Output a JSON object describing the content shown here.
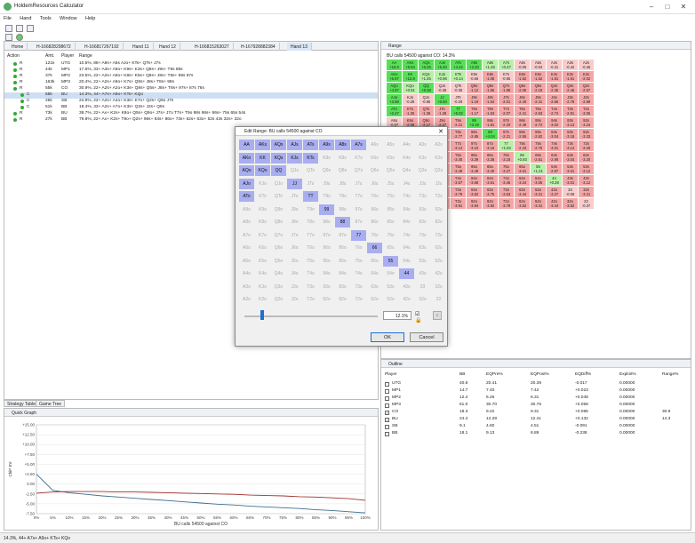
{
  "window": {
    "title": "HoldemResources Calculator"
  },
  "menu": [
    "File",
    "Hand",
    "Tools",
    "Window",
    "Help"
  ],
  "tabs": [
    "Home",
    "H-166828298672",
    "H-166817267192",
    "Hand 11",
    "Hand 12",
    "H-166815263027",
    "H-167928882384",
    "Hand 13"
  ],
  "hand_table": {
    "headers": [
      "Action",
      "Amt.",
      "Player",
      "Range"
    ],
    "rows": [
      {
        "action": "R",
        "amt": "121k",
        "player": "UTG",
        "range": "10.5%, 88+ A9s+ A5s AJo+ KTs+ QTs+ J7s"
      },
      {
        "action": "R",
        "amt": "44k",
        "player": "MP1",
        "range": "17.6%, 33+ A3s+ A9o+ K9s+ K3s+ Q8s+ J9s+ T9s 89s"
      },
      {
        "action": "R",
        "amt": "37k",
        "player": "MP2",
        "range": "23.5%, 22+ A2s+ A8o+ K8s+ K5s+ Q8s+ J8s+ T8s+ 98s 87s"
      },
      {
        "action": "R",
        "amt": "163k",
        "player": "MP3",
        "range": "20.4%, 22+ A2s+ A9o+ K7s+ Q9s+ J8s+ T8s+ 98s"
      },
      {
        "action": "R",
        "amt": "55k",
        "player": "CO",
        "range": "30.9%, 22+ A2s+ A2o+ K3s+ Q8s+ Q5s+ J8s+ T8s+ 97s+ 87s 76s"
      },
      {
        "action": "C",
        "amt": "55k",
        "player": "BU",
        "range": "14.3%, 44+ A7s+ A9o+ KTs+ KQo"
      },
      {
        "action": "C",
        "amt": "25k",
        "player": "SB",
        "range": "24.9%, 22+ A2s+ A4o+ K3s+ K7o+ Q2s+ Q9o J7s"
      },
      {
        "action": "C",
        "amt": "51k",
        "player": "BB",
        "range": "18.4%, 33+ A2s+ A7o+ K3s+ Q3s+ J2s+ Q9s"
      },
      {
        "action": "R",
        "amt": "73k",
        "player": "BU",
        "range": "39.7%, 22+ Ax+ K2s+ K8o+ Q5s+ Q9o+ J7s+ J7o T7s+ T9o 98s 96s+ 86s+ 75s 65s 54s"
      },
      {
        "action": "R",
        "amt": "27k",
        "player": "BB",
        "range": "79.8%, 22+ Ax+ K2s+ T8o+ Q2s+ 96s+ 84s+ 86o+ 73s+ 62s+ 63o+ 52s 43s 32s+ 32o"
      }
    ]
  },
  "bottom_tabs": [
    "Strategy Table",
    "Game Tree"
  ],
  "graph": {
    "title": "Quick Graph",
    "chart_data": {
      "type": "line",
      "x": [
        0,
        5,
        10,
        15,
        20,
        25,
        30,
        35,
        40,
        45,
        50,
        55,
        60,
        65,
        70,
        75,
        80,
        85,
        90,
        95,
        100
      ],
      "series": [
        {
          "values": [
            2.5,
            -1.6,
            -2.2,
            -2.6,
            -3.0,
            -3.3,
            -3.6,
            -3.9,
            -4.2,
            -4.5,
            -4.8,
            -5.1,
            -5.3,
            -5.6,
            -5.8,
            -6.0,
            -6.2,
            -6.5,
            -6.7,
            -7.0,
            -7.3
          ],
          "color": "#3f6f8f"
        },
        {
          "values": [
            -2.3,
            -2.0,
            -1.9,
            -1.9,
            -1.9,
            -2.0,
            -2.0,
            -2.1,
            -2.2,
            -2.3,
            -2.4,
            -2.5,
            -2.6,
            -2.8,
            -2.9,
            -3.0,
            -3.2,
            -3.3,
            -3.5,
            -3.7,
            -4.1
          ],
          "color": "#a03030"
        }
      ],
      "yticks": [
        "+15.00",
        "+12.50",
        "+10.00",
        "+7.50",
        "+5.00",
        "+2.50",
        "0.00",
        "-2.50",
        "-5.00",
        "-7.50"
      ],
      "xticks": [
        "0%",
        "5%",
        "10%",
        "15%",
        "20%",
        "25%",
        "30%",
        "35%",
        "40%",
        "45%",
        "50%",
        "55%",
        "60%",
        "65%",
        "70%",
        "75%",
        "80%",
        "85%",
        "90%",
        "95%",
        "100%"
      ],
      "ylim": [
        -7.5,
        15
      ],
      "xlabel": "BU calls 54500 against CO",
      "ylabel": "ChiP EV"
    }
  },
  "range_panel": {
    "head": "Range",
    "title": "BU calls 54500 against CO: 14.3%",
    "grid": [
      [
        "AA",
        "AKs",
        "AQs",
        "AJs",
        "ATs",
        "A9s",
        "A8s",
        "A7s",
        "A6s",
        "A5s",
        "A4s",
        "A3s",
        "A2s"
      ],
      [
        "AKo",
        "KK",
        "KQs",
        "KJs",
        "KTs",
        "K9s",
        "K8s",
        "K7s",
        "K6s",
        "K5s",
        "K4s",
        "K3s",
        "K2s"
      ],
      [
        "AQo",
        "KQo",
        "QQ",
        "QJs",
        "QTs",
        "Q9s",
        "Q8s",
        "Q7s",
        "Q6s",
        "Q5s",
        "Q4s",
        "Q3s",
        "Q2s"
      ],
      [
        "AJo",
        "KJo",
        "QJo",
        "JJ",
        "JTs",
        "J9s",
        "J8s",
        "J7s",
        "J6s",
        "J5s",
        "J4s",
        "J3s",
        "J2s"
      ],
      [
        "ATo",
        "KTo",
        "QTo",
        "JTo",
        "TT",
        "T9s",
        "T8s",
        "T7s",
        "T6s",
        "T5s",
        "T4s",
        "T3s",
        "T2s"
      ],
      [
        "A9o",
        "K9o",
        "Q9o",
        "J9o",
        "T9o",
        "99",
        "98s",
        "97s",
        "96s",
        "95s",
        "94s",
        "93s",
        "92s"
      ],
      [
        "A8o",
        "K8o",
        "Q8o",
        "J8o",
        "T8o",
        "98o",
        "88",
        "87s",
        "86s",
        "85s",
        "84s",
        "83s",
        "82s"
      ],
      [
        "A7o",
        "K7o",
        "Q7o",
        "J7o",
        "T7o",
        "97o",
        "87o",
        "77",
        "76s",
        "75s",
        "74s",
        "73s",
        "72s"
      ],
      [
        "A6o",
        "K6o",
        "Q6o",
        "J6o",
        "T6o",
        "96o",
        "86o",
        "76o",
        "66",
        "65s",
        "64s",
        "63s",
        "62s"
      ],
      [
        "A5o",
        "K5o",
        "Q5o",
        "J5o",
        "T5o",
        "95o",
        "85o",
        "75o",
        "65o",
        "55",
        "54s",
        "53s",
        "52s"
      ],
      [
        "A4o",
        "K4o",
        "Q4o",
        "J4o",
        "T4o",
        "94o",
        "84o",
        "74o",
        "64o",
        "54o",
        "44",
        "43s",
        "42s"
      ],
      [
        "A3o",
        "K3o",
        "Q3o",
        "J3o",
        "T3o",
        "93o",
        "83o",
        "73o",
        "63o",
        "53o",
        "43o",
        "33",
        "32s"
      ],
      [
        "A2o",
        "K2o",
        "Q2o",
        "J2o",
        "T2o",
        "92o",
        "82o",
        "72o",
        "62o",
        "52o",
        "42o",
        "32o",
        "22"
      ]
    ],
    "values": [
      [
        "+15.8",
        "+8.94",
        "+6.25",
        "+5.40",
        "+4.42",
        "+2.20",
        "+1.45",
        "+0.47",
        "-0.06",
        "-0.04",
        "-0.31",
        "-0.42",
        "-0.46"
      ],
      [
        "+6.97",
        "+12.8",
        "+1.45",
        "+0.96",
        "+0.14",
        "-0.66",
        "-1.08",
        "-0.95",
        "-1.62",
        "-1.52",
        "-1.81",
        "-1.91",
        "-2.02"
      ],
      [
        "+4.97",
        "+0.91",
        "+8.38",
        "-0.38",
        "-0.35",
        "-1.12",
        "-1.55",
        "-1.88",
        "-2.09",
        "-2.19",
        "-2.35",
        "-2.46",
        "-2.57"
      ],
      [
        "+3.98",
        "-0.28",
        "-0.86",
        "+6.60",
        "-0.29",
        "-1.19",
        "-1.64",
        "-2.01",
        "-2.40",
        "-2.41",
        "-2.65",
        "-2.78",
        "-2.89"
      ],
      [
        "+2.47",
        "-1.25",
        "-1.36",
        "-1.28",
        "+5.02",
        "-1.17",
        "-1.63",
        "-2.07",
        "-2.41",
        "-2.63",
        "-2.74",
        "-2.91",
        "-3.05"
      ],
      [
        "-0.07",
        "-2.08",
        "-2.17",
        "-2.27",
        "-2.21",
        "+3.19",
        "-1.81",
        "-2.20",
        "-2.49",
        "-2.72",
        "-3.02",
        "-3.13",
        "-3.24"
      ],
      [
        "-1.18",
        "-2.42",
        "-2.65",
        "-2.79",
        "-2.77",
        "-2.85",
        "+4.04",
        "-2.21",
        "-2.55",
        "-2.82",
        "-3.04",
        "-3.18",
        "-3.33"
      ],
      [
        "-1.64",
        "-2.90",
        "-3.01",
        "-3.13",
        "-3.14",
        "-3.10",
        "-3.16",
        "+1.94",
        "-2.43",
        "-2.76",
        "-3.01",
        "-3.14",
        "-3.26"
      ],
      [
        "-2.28",
        "-3.18",
        "-3.29",
        "-3.42",
        "-3.40",
        "-3.39",
        "-3.36",
        "-3.18",
        "+0.93",
        "-2.61",
        "-2.90",
        "-3.04",
        "-3.20"
      ],
      [
        "-2.09",
        "-3.24",
        "-3.36",
        "-3.46",
        "-3.49",
        "-3.49",
        "-3.40",
        "-3.27",
        "-3.01",
        "+1.21",
        "-2.87",
        "-3.01",
        "-3.12"
      ],
      [
        "-2.47",
        "-3.42",
        "-3.55",
        "-3.64",
        "-3.67",
        "-3.68",
        "-3.61",
        "-3.45",
        "-3.24",
        "-3.05",
        "+0.28",
        "-3.01",
        "-3.12"
      ],
      [
        "-2.69",
        "-3.48",
        "-3.67",
        "-3.75",
        "-3.79",
        "-3.82",
        "-3.75",
        "-3.63",
        "-3.44",
        "-3.21",
        "-3.27",
        "-0.08",
        "-3.21"
      ],
      [
        "-2.76",
        "-3.55",
        "-3.76",
        "-3.87",
        "-3.91",
        "-3.94",
        "-3.92",
        "-3.79",
        "-3.62",
        "-3.41",
        "-3.44",
        "-3.52",
        "-0.37"
      ]
    ],
    "colors": {
      "pos_strong": "#56e056",
      "pos_weak": "#b8f0a8",
      "neg": "#f4a6a6",
      "neg_weak": "#f9cccc"
    }
  },
  "outline": {
    "head": "Outline",
    "headers": [
      "Player",
      "BB",
      "EQPre%",
      "EQPost%",
      "EQDiff%",
      "Exploit%",
      "Range%"
    ],
    "rows": [
      {
        "checked": false,
        "player": "UTG",
        "bb": "40.6",
        "eqpre": "20.41",
        "eqpost": "20.39",
        "eqdiff": "-0.017",
        "exploit": "0.00000",
        "range": ""
      },
      {
        "checked": false,
        "player": "MP1",
        "bb": "14.7",
        "eqpre": "7.40",
        "eqpost": "7.42",
        "eqdiff": "+0.023",
        "exploit": "0.00000",
        "range": ""
      },
      {
        "checked": false,
        "player": "MP2",
        "bb": "12.4",
        "eqpre": "6.26",
        "eqpost": "6.31",
        "eqdiff": "+0.048",
        "exploit": "0.00000",
        "range": ""
      },
      {
        "checked": false,
        "player": "MP3",
        "bb": "61.0",
        "eqpre": "30.70",
        "eqpost": "30.76",
        "eqdiff": "+0.058",
        "exploit": "0.00000",
        "range": ""
      },
      {
        "checked": true,
        "player": "CO",
        "bb": "18.3",
        "eqpre": "9.22",
        "eqpost": "9.31",
        "eqdiff": "+0.085",
        "exploit": "0.00000",
        "range": "30.9"
      },
      {
        "checked": true,
        "player": "BU",
        "bb": "24.4",
        "eqpre": "12.28",
        "eqpost": "12.41",
        "eqdiff": "+0.132",
        "exploit": "0.00000",
        "range": "14.3"
      },
      {
        "checked": false,
        "player": "SB",
        "bb": "9.1",
        "eqpre": "4.60",
        "eqpost": "4.51",
        "eqdiff": "-0.091",
        "exploit": "0.00000",
        "range": ""
      },
      {
        "checked": false,
        "player": "BB",
        "bb": "18.1",
        "eqpre": "9.13",
        "eqpost": "8.89",
        "eqdiff": "-0.238",
        "exploit": "0.00000",
        "range": ""
      }
    ]
  },
  "dialog": {
    "title": "Edit Range: BU calls 54500 against CO",
    "selected": [
      "AA",
      "AKs",
      "AQs",
      "AJs",
      "ATs",
      "A9s",
      "A8s",
      "A7s",
      "AKo",
      "KK",
      "KQs",
      "KJs",
      "KTs",
      "AQo",
      "KQo",
      "QQ",
      "AJo",
      "JJ",
      "ATo",
      "TT",
      "99",
      "88",
      "77",
      "66",
      "55",
      "44"
    ],
    "percent": "12.1%",
    "slider_fraction": 0.121,
    "ok_label": "OK",
    "cancel_label": "Cancel"
  },
  "status": "14.3%, 44+ A7s+ A9o+ KTs+ KQo"
}
